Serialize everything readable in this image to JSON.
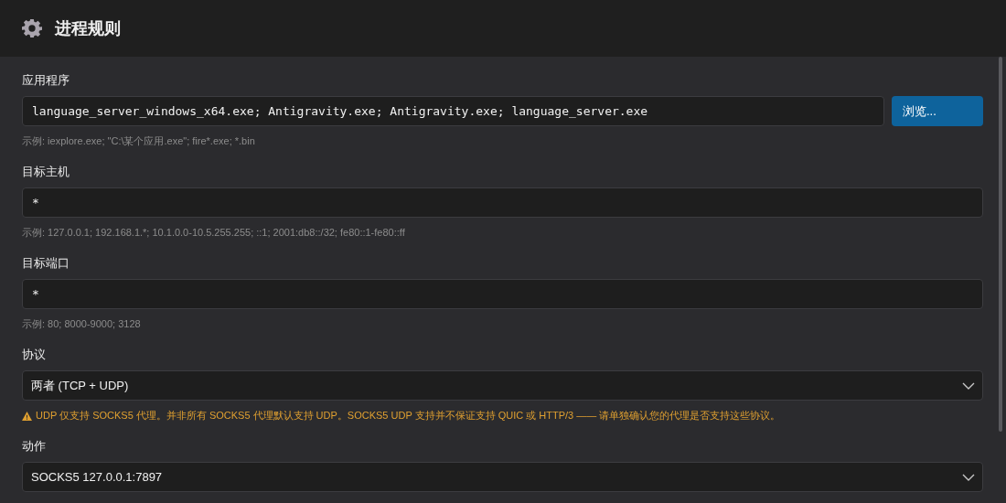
{
  "header": {
    "title": "进程规则"
  },
  "fields": [
    {
      "kind": "text",
      "label": "应用程序",
      "value": "language_server_windows_x64.exe; Antigravity.exe; Antigravity.exe; language_server.exe",
      "button": "浏览...",
      "hint": "示例: iexplore.exe; \"C:\\某个应用.exe\"; fire*.exe; *.bin"
    },
    {
      "kind": "text",
      "label": "目标主机",
      "value": "*",
      "hint": "示例: 127.0.0.1; 192.168.1.*; 10.1.0.0-10.5.255.255; ::1; 2001:db8::/32; fe80::1-fe80::ff"
    },
    {
      "kind": "text",
      "label": "目标端口",
      "value": "*",
      "hint": "示例: 80; 8000-9000; 3128"
    },
    {
      "kind": "select",
      "label": "协议",
      "value": "两者 (TCP + UDP)",
      "warning": "UDP 仅支持 SOCKS5 代理。并非所有 SOCKS5 代理默认支持 UDP。SOCKS5 UDP 支持并不保证支持 QUIC 或 HTTP/3 —— 请单独确认您的代理是否支持这些协议。"
    },
    {
      "kind": "select",
      "label": "动作",
      "value": "SOCKS5 127.0.0.1:7897"
    }
  ]
}
